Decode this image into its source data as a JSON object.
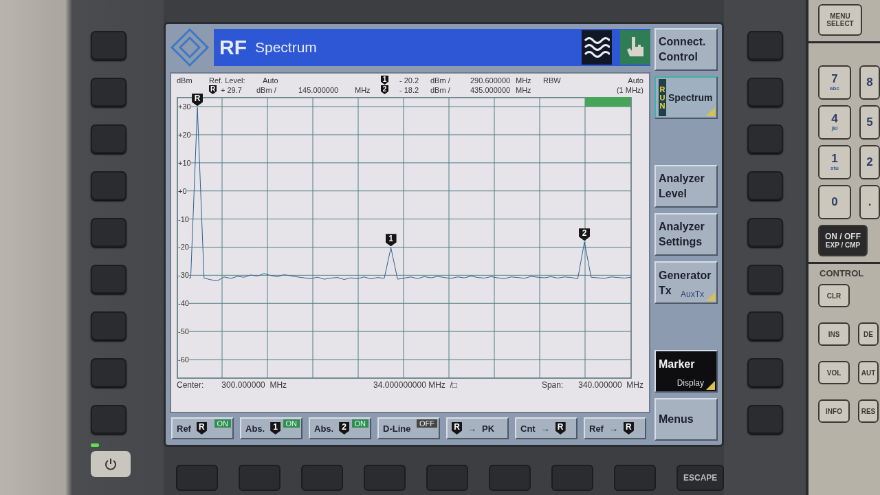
{
  "title_bar": {
    "logo_text": "RF",
    "title": "Spectrum"
  },
  "readout": {
    "unit": "dBm",
    "ref_label": "Ref. Level:",
    "ref_mode": "Auto",
    "ref_marker": "R",
    "ref_value": "+ 29.7",
    "ref_unit": "dBm /",
    "ref_freq": "145.000000",
    "ref_freq_unit": "MHz",
    "markers": [
      {
        "marker": "1",
        "value": "- 20.2",
        "unit": "dBm /",
        "freq": "290.600000",
        "freq_unit": "MHz"
      },
      {
        "marker": "2",
        "value": "- 18.2",
        "unit": "dBm /",
        "freq": "435.000000",
        "freq_unit": "MHz"
      }
    ],
    "rbw_label": "RBW",
    "rbw_mode": "Auto",
    "rbw_value": "(1 MHz)"
  },
  "plot": {
    "chart_data": {
      "type": "line",
      "grid": true,
      "ylim": [
        -66.6,
        33.2
      ],
      "yticks": [
        {
          "value": 30,
          "label": "+30"
        },
        {
          "value": 20,
          "label": "+20"
        },
        {
          "value": 10,
          "label": "+10"
        },
        {
          "value": 0,
          "label": "+0"
        },
        {
          "value": -10,
          "label": "-10"
        },
        {
          "value": -20,
          "label": "-20"
        },
        {
          "value": -30,
          "label": "-30"
        },
        {
          "value": -40,
          "label": "-40"
        },
        {
          "value": -50,
          "label": "-50"
        },
        {
          "value": -60,
          "label": "-60"
        }
      ],
      "categories": [
        null,
        null,
        null,
        null,
        null,
        null,
        null,
        null,
        null,
        null,
        null,
        null,
        null,
        null,
        null,
        null,
        null,
        null,
        null,
        null,
        null,
        null,
        null,
        null,
        null,
        null,
        null,
        null,
        null,
        null,
        null,
        null,
        null,
        null,
        null,
        null,
        null,
        null,
        null,
        null,
        null,
        null,
        null,
        null,
        null,
        null,
        null,
        null,
        null,
        null,
        null,
        null,
        null,
        null,
        null,
        null,
        null,
        null,
        null,
        null,
        null,
        null,
        null,
        null,
        null,
        null,
        null,
        null,
        null
      ],
      "series": [
        {
          "color": "#2e5f8f",
          "values": [
            -30.8,
            -31.2,
            -30.9,
            29.7,
            -31.0,
            -31.6,
            -32.0,
            -30.6,
            -31.1,
            -30.4,
            -30.7,
            -29.9,
            -30.3,
            -29.4,
            -30.1,
            -30.5,
            -29.8,
            -30.2,
            -30.6,
            -30.9,
            -31.2,
            -30.7,
            -31.4,
            -31.0,
            -30.8,
            -31.5,
            -30.9,
            -31.2,
            -30.6,
            -31.3,
            -30.8,
            -31.1,
            -20.2,
            -31.4,
            -31.0,
            -30.6,
            -31.2,
            -30.5,
            -30.9,
            -30.4,
            -30.8,
            -31.1,
            -30.6,
            -30.9,
            -30.3,
            -30.8,
            -31.0,
            -30.5,
            -30.9,
            -31.2,
            -30.6,
            -30.8,
            -31.1,
            -30.4,
            -30.7,
            -30.9,
            -30.5,
            -31.0,
            -30.6,
            -30.8,
            -31.2,
            -18.2,
            -30.7,
            -30.9,
            -31.1,
            -30.6,
            -30.8,
            -31.0,
            -30.7
          ]
        }
      ]
    },
    "markers": [
      {
        "label": "R"
      },
      {
        "label": "1"
      },
      {
        "label": "2"
      }
    ]
  },
  "footer": {
    "center_label": "Center:",
    "center_value": "300.000000  MHz",
    "scale": "34.000000000 MHz  /□",
    "span_label": "Span:",
    "span_value": "340.000000  MHz"
  },
  "bottom_softkeys": [
    {
      "parts": [
        {
          "kind": "text",
          "text": "Ref"
        },
        {
          "kind": "marker",
          "text": "R"
        }
      ],
      "status": {
        "text": "ON",
        "on": true
      }
    },
    {
      "parts": [
        {
          "kind": "text",
          "text": "Abs."
        },
        {
          "kind": "marker",
          "text": "1"
        }
      ],
      "status": {
        "text": "ON",
        "on": true
      }
    },
    {
      "parts": [
        {
          "kind": "text",
          "text": "Abs."
        },
        {
          "kind": "marker",
          "text": "2"
        }
      ],
      "status": {
        "text": "ON",
        "on": true
      }
    },
    {
      "parts": [
        {
          "kind": "text",
          "text": "D-Line"
        }
      ],
      "status": {
        "text": "OFF",
        "on": false
      }
    },
    {
      "parts": [
        {
          "kind": "marker",
          "text": "R"
        },
        {
          "kind": "text",
          "text": "→"
        },
        {
          "kind": "text",
          "text": "PK"
        }
      ]
    },
    {
      "parts": [
        {
          "kind": "text",
          "text": "Cnt"
        },
        {
          "kind": "text",
          "text": "→"
        },
        {
          "kind": "marker",
          "text": "R"
        }
      ]
    },
    {
      "parts": [
        {
          "kind": "text",
          "text": "Ref"
        },
        {
          "kind": "text",
          "text": "→"
        },
        {
          "kind": "marker",
          "text": "R"
        }
      ]
    }
  ],
  "side_softkeys": [
    [
      {
        "title": "Connect. Control",
        "kind": "plain",
        "selected": false
      },
      {
        "title": "Spectrum",
        "kind": "mode",
        "run": "RUN",
        "selected": true
      }
    ],
    [
      {
        "title": "Analyzer Level",
        "kind": "plain",
        "selected": false
      },
      {
        "title": "Analyzer Settings",
        "kind": "plain",
        "selected": false
      },
      {
        "title": "Generator Tx",
        "kind": "sub",
        "sub": "AuxTx",
        "selected": false
      }
    ],
    [
      {
        "title": "Marker",
        "kind": "sub",
        "sub": "Display",
        "selected": true
      },
      {
        "title": "Menus",
        "kind": "plain",
        "selected": false
      }
    ]
  ],
  "escape_key": "ESCAPE",
  "keypad": {
    "top_key": {
      "line1": "MENU",
      "line2": "SELECT"
    },
    "digit_rows": [
      [
        {
          "main": "7",
          "sub": "abc"
        },
        {
          "main": "8"
        }
      ],
      [
        {
          "main": "4",
          "sub": "jkl"
        },
        {
          "main": "5"
        }
      ],
      [
        {
          "main": "1",
          "sub": "stu"
        },
        {
          "main": "2"
        }
      ],
      [
        {
          "main": "0"
        },
        {
          "main": "."
        }
      ]
    ],
    "onoff": {
      "line1": "ON / OFF",
      "line2": "EXP / CMP"
    },
    "control_title": "CONTROL",
    "control_rows": [
      [
        "CLR"
      ],
      [
        "INS",
        "DE"
      ],
      [
        "VOL",
        "AUT"
      ],
      [
        "INFO",
        "RES"
      ]
    ]
  }
}
